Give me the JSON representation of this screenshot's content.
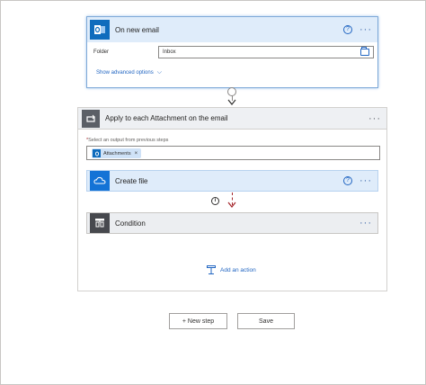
{
  "trigger": {
    "title": "On new email",
    "help": "?",
    "more": "···",
    "folder_label": "Folder",
    "folder_value": "Inbox",
    "advanced_link": "Show advanced options",
    "advanced_chevron": "⌵"
  },
  "loop": {
    "title": "Apply to each Attachment on the email",
    "more": "···",
    "required_mark": "*",
    "select_label": "Select an output from previous steps",
    "token_label": "Attachments",
    "token_remove": "×"
  },
  "create_file": {
    "title": "Create file",
    "help": "?",
    "more": "···"
  },
  "info_mark": "i",
  "condition": {
    "title": "Condition",
    "more": "···"
  },
  "add_action": {
    "label": "Add an action"
  },
  "footer": {
    "new_step": "+ New step",
    "save": "Save"
  },
  "colors": {
    "accent": "#2266c2",
    "outlook": "#0f6cbd",
    "onedrive": "#1473d6",
    "error": "#a4262c"
  }
}
